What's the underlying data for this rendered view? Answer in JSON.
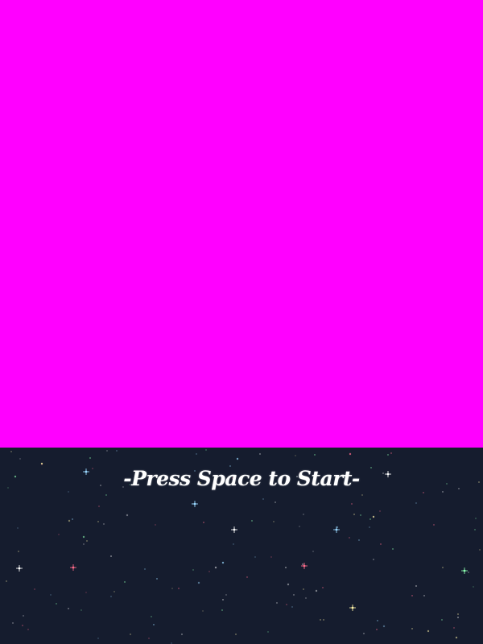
{
  "game": {
    "prompt": "-Press Space to Start-",
    "top_panel_color": "#ff00ff",
    "background_color": "#151c2e",
    "star_colors": [
      "#ffffff",
      "#9ad8ff",
      "#fff3a8",
      "#ff6b8a",
      "#8dffb0"
    ]
  }
}
